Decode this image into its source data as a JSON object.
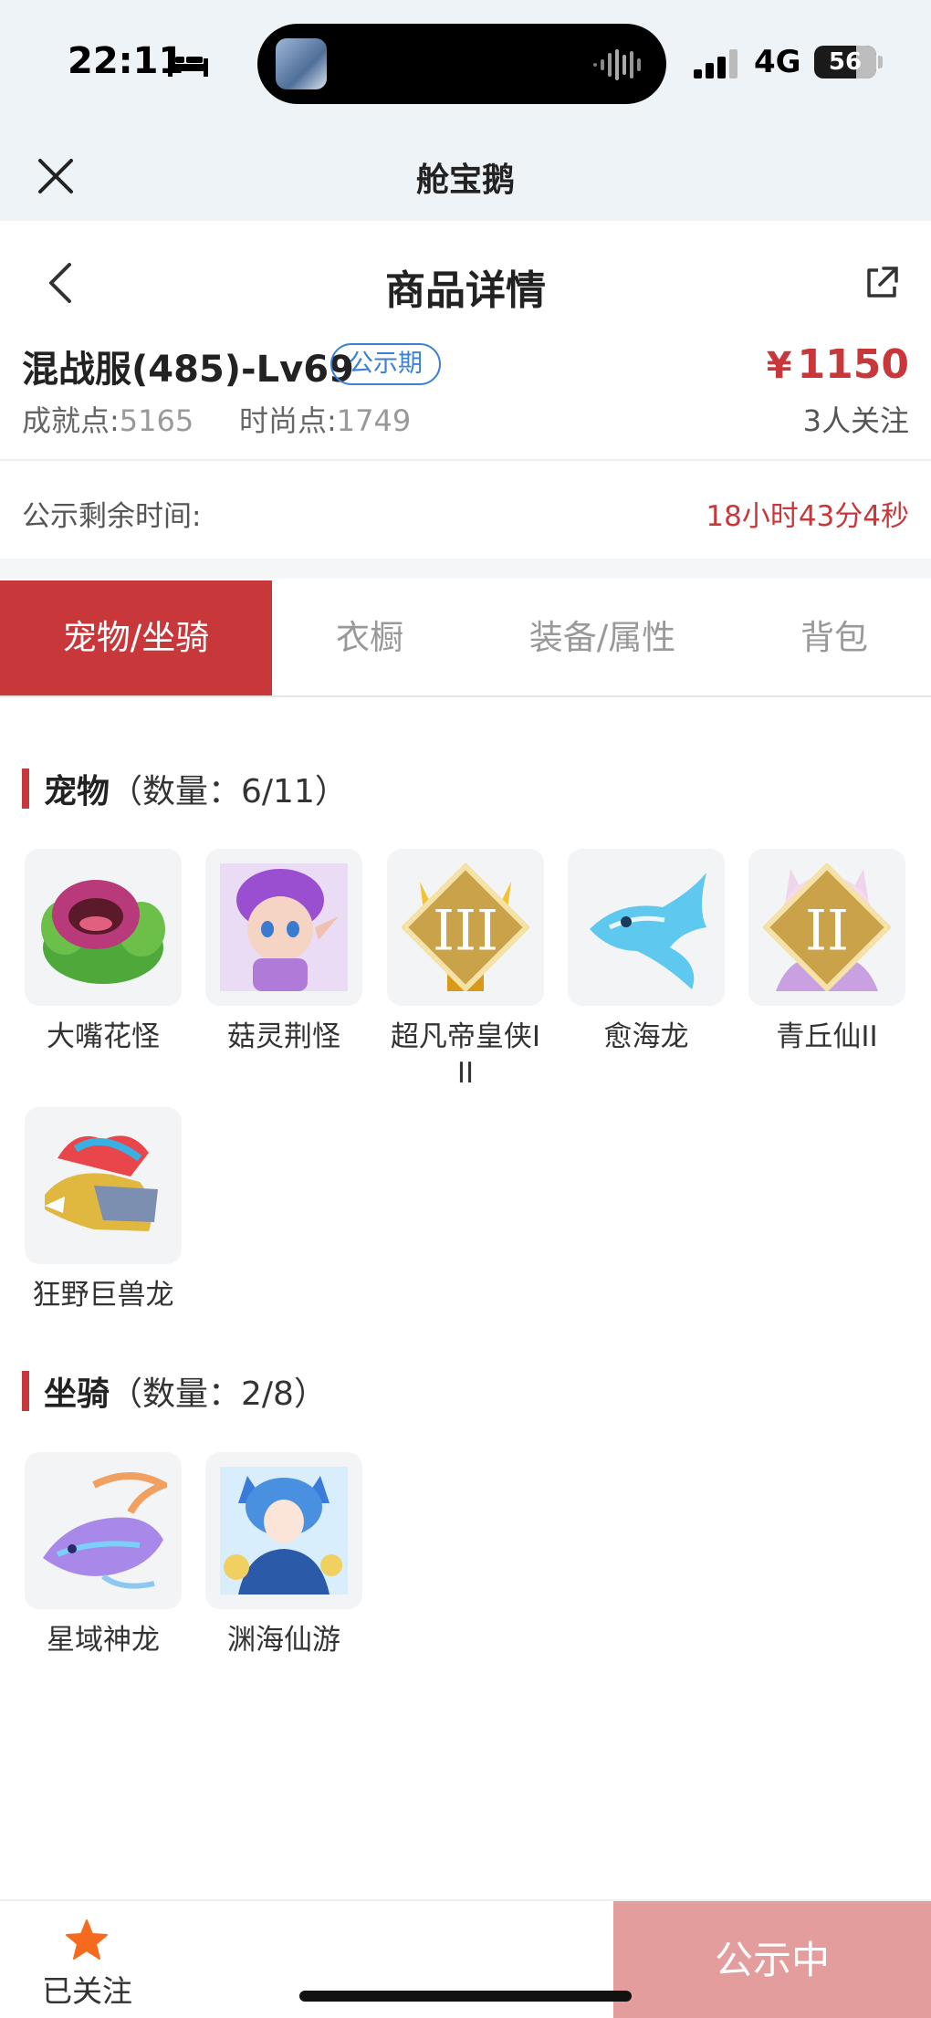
{
  "status_bar": {
    "time": "22:11",
    "network": "4G",
    "battery": "56",
    "battery_level_percent": 56,
    "icons": [
      "bed-icon",
      "signal-icon",
      "sound-wave-icon"
    ]
  },
  "mini_app": {
    "title": "舱宝鹅",
    "close_icon": "close-icon"
  },
  "nav": {
    "title": "商品详情",
    "back_icon": "chevron-left-icon",
    "share_icon": "share-icon"
  },
  "product": {
    "name": "混战服(485)-Lv69",
    "badge": "公示期",
    "currency": "¥",
    "price": "1150",
    "achievement_label": "成就点:",
    "achievement_value": "5165",
    "fashion_label": "时尚点:",
    "fashion_value": "1749",
    "followers": "3人关注"
  },
  "countdown": {
    "label": "公示剩余时间:",
    "value": "18小时43分4秒"
  },
  "tabs": [
    {
      "label": "宠物/坐骑",
      "active": true
    },
    {
      "label": "衣橱",
      "active": false
    },
    {
      "label": "装备/属性",
      "active": false
    },
    {
      "label": "背包",
      "active": false
    }
  ],
  "pets": {
    "title": "宠物",
    "count": "（数量：6/11）",
    "items": [
      {
        "name": "大嘴花怪",
        "tier": ""
      },
      {
        "name": "菇灵荆怪",
        "tier": ""
      },
      {
        "name": "超凡帝皇侠III",
        "tier": "III"
      },
      {
        "name": "愈海龙",
        "tier": ""
      },
      {
        "name": "青丘仙II",
        "tier": "II"
      },
      {
        "name": "狂野巨兽龙",
        "tier": ""
      }
    ]
  },
  "mounts": {
    "title": "坐骑",
    "count": "（数量：2/8）",
    "items": [
      {
        "name": "星域神龙"
      },
      {
        "name": "渊海仙游"
      }
    ]
  },
  "bottom": {
    "follow_label": "已关注",
    "publish_label": "公示中"
  },
  "colors": {
    "accent": "#c8373a",
    "badge_blue": "#3b82d6",
    "publish_bg": "#e29d9c",
    "header_bg": "#eef3f7"
  }
}
